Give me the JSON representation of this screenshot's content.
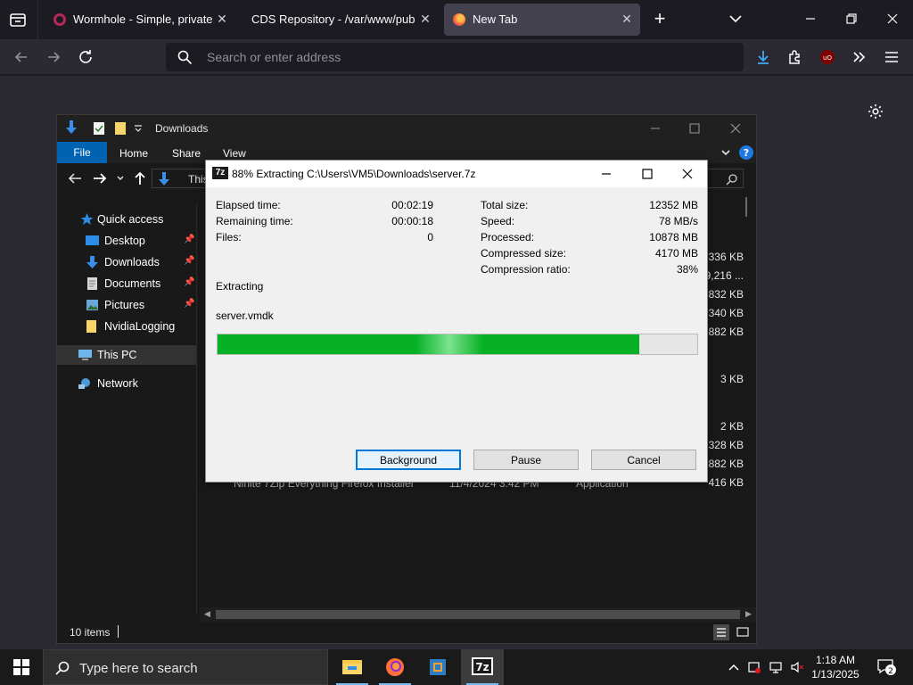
{
  "browser": {
    "tabs": [
      {
        "title": "Wormhole - Simple, private file"
      },
      {
        "title": "CDS Repository - /var/www/public"
      },
      {
        "title": "New Tab"
      }
    ],
    "url_placeholder": "Search or enter address",
    "close_glyph": "✕",
    "new_tab_glyph": "+"
  },
  "explorer": {
    "title": "Downloads",
    "ribbon": {
      "file": "File",
      "home": "Home",
      "share": "Share",
      "view": "View"
    },
    "address_partial": "This",
    "sidebar": {
      "quick_access": "Quick access",
      "items": [
        "Desktop",
        "Downloads",
        "Documents",
        "Pictures",
        "NvidiaLogging"
      ],
      "this_pc": "This PC",
      "network": "Network"
    },
    "visible_sizes": [
      "336 KB",
      "9,216 ...",
      "832 KB",
      "340 KB",
      "882 KB",
      "3 KB",
      "2 KB",
      "328 KB",
      "882 KB",
      "416 KB"
    ],
    "behind_row": {
      "name": "Ninite 7Zip Everything Firefox Installer",
      "date": "11/4/2024 3:42 PM",
      "type": "Application"
    },
    "status_items": "10 items"
  },
  "zip_dialog": {
    "title": "88% Extracting C:\\Users\\VM5\\Downloads\\server.7z",
    "logo": "7z",
    "left_stats": [
      {
        "label": "Elapsed time:",
        "value": "00:02:19"
      },
      {
        "label": "Remaining time:",
        "value": "00:00:18"
      },
      {
        "label": "Files:",
        "value": "0"
      }
    ],
    "right_stats": [
      {
        "label": "Total size:",
        "value": "12352 MB"
      },
      {
        "label": "Speed:",
        "value": "78 MB/s"
      },
      {
        "label": "Processed:",
        "value": "10878 MB"
      },
      {
        "label": "Compressed size:",
        "value": "4170 MB"
      },
      {
        "label": "Compression ratio:",
        "value": "38%"
      }
    ],
    "operation": "Extracting",
    "current_file": "server.vmdk",
    "progress_fraction": 0.88,
    "buttons": {
      "background": "Background",
      "pause": "Pause",
      "cancel": "Cancel"
    }
  },
  "taskbar": {
    "search_placeholder": "Type here to search",
    "time": "1:18 AM",
    "date": "1/13/2025",
    "notifications": "2"
  },
  "colors": {
    "progress_green": "#06b025",
    "accent_blue": "#0078d7",
    "ribbon_file": "#0063b1"
  }
}
